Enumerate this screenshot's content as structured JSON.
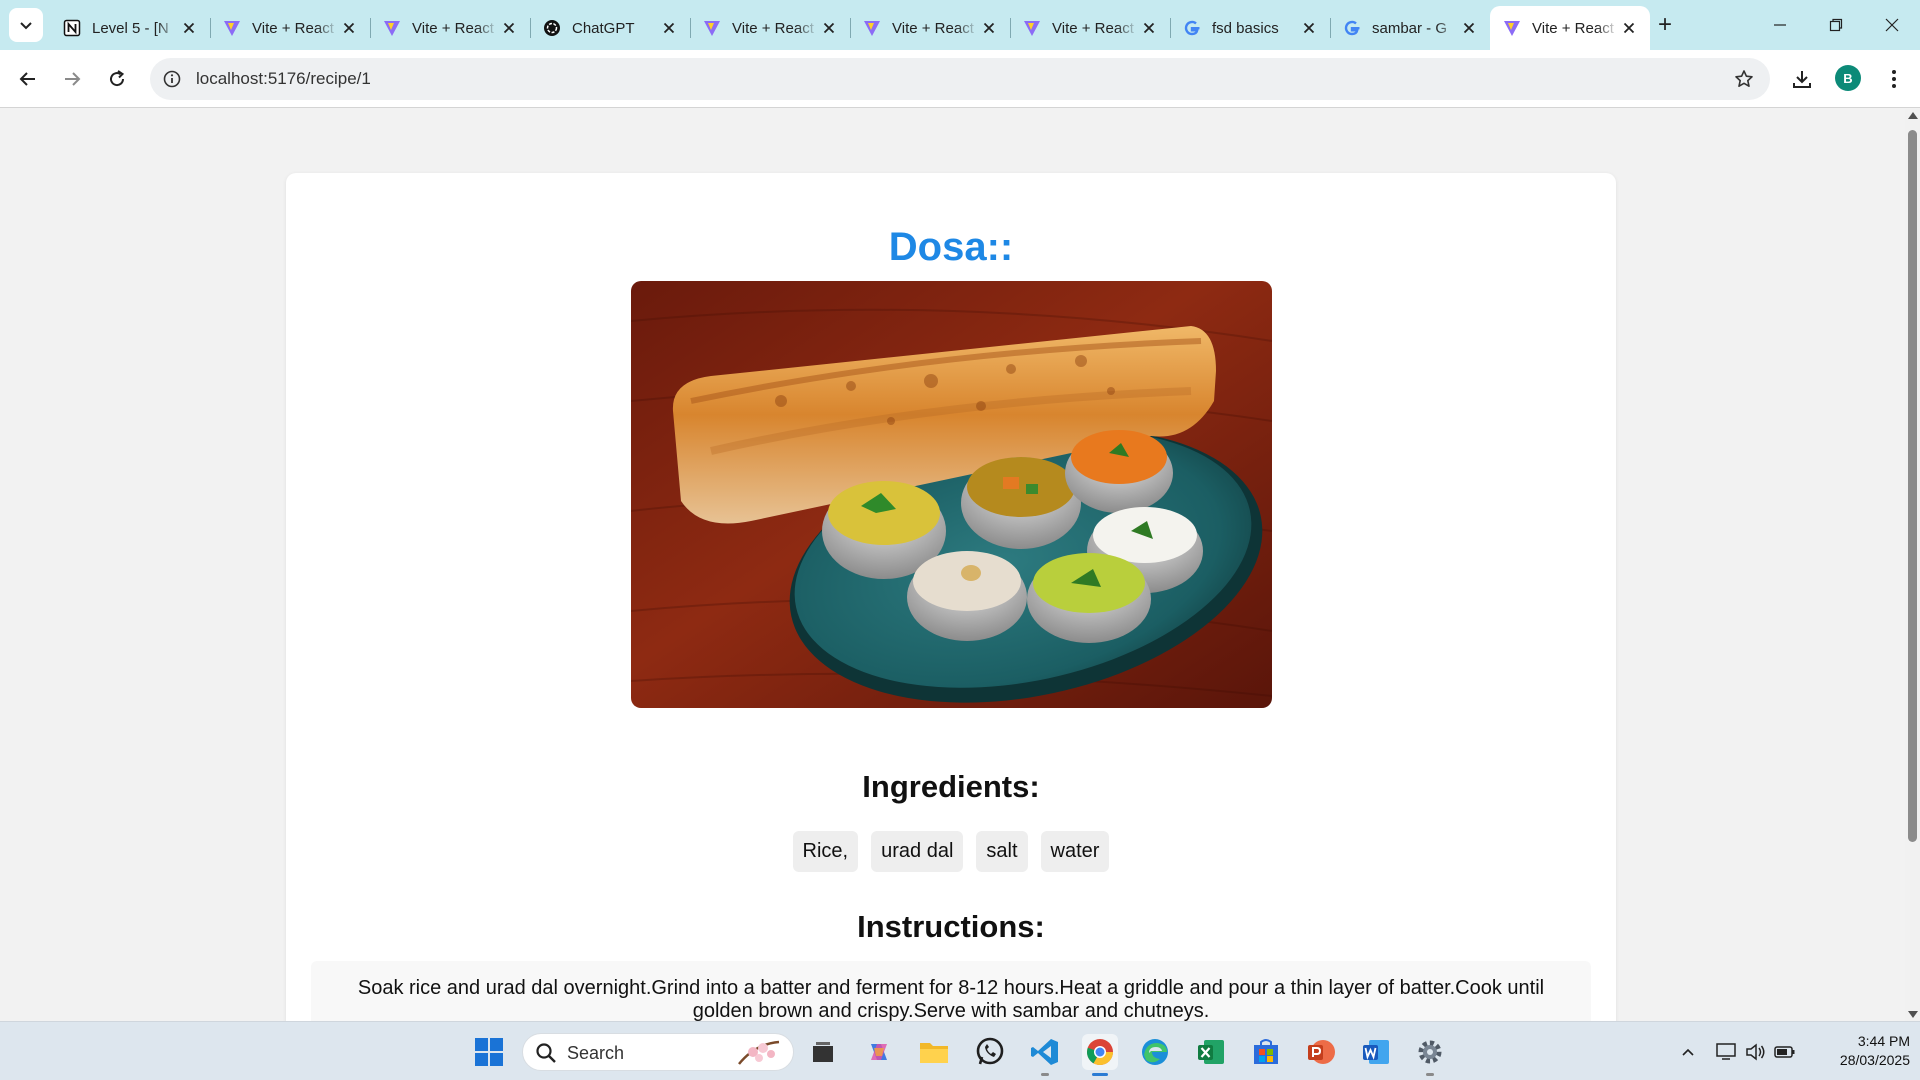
{
  "browser": {
    "tabs": [
      {
        "title": "Level 5 - [N",
        "icon": "notion-icon",
        "active": false
      },
      {
        "title": "Vite + React",
        "icon": "vite-icon",
        "active": false
      },
      {
        "title": "Vite + React",
        "icon": "vite-icon",
        "active": false
      },
      {
        "title": "ChatGPT",
        "icon": "chatgpt-icon",
        "active": false
      },
      {
        "title": "Vite + React",
        "icon": "vite-icon",
        "active": false
      },
      {
        "title": "Vite + React",
        "icon": "vite-icon",
        "active": false
      },
      {
        "title": "Vite + React",
        "icon": "vite-icon",
        "active": false
      },
      {
        "title": "fsd basics",
        "icon": "google-icon",
        "active": false
      },
      {
        "title": "sambar - G",
        "icon": "google-icon",
        "active": false
      },
      {
        "title": "Vite + React",
        "icon": "vite-icon",
        "active": true
      }
    ],
    "url": "localhost:5176/recipe/1",
    "profile_initial": "B",
    "colors": {
      "tabstrip": "#c6eaf0",
      "avatar": "#0c8a78"
    }
  },
  "recipe": {
    "title": "Dosa::",
    "image_alt": "Dosa with chutneys and sambar",
    "ingredients_heading": "Ingredients:",
    "ingredients": [
      "Rice,",
      "urad dal",
      "salt",
      "water"
    ],
    "instructions_heading": "Instructions:",
    "instructions": "Soak rice and urad dal overnight.Grind into a batter and ferment for 8-12 hours.Heat a griddle and pour a thin layer of batter.Cook until golden brown and crispy.Serve with sambar and chutneys.",
    "colors": {
      "title": "#1e88e5"
    }
  },
  "taskbar": {
    "search_placeholder": "Search",
    "apps": [
      "start-icon",
      "task-view-icon",
      "copilot-icon",
      "file-explorer-icon",
      "whatsapp-icon",
      "vscode-icon",
      "chrome-icon",
      "edge-icon",
      "excel-icon",
      "store-icon",
      "powerpoint-icon",
      "word-icon",
      "settings-icon"
    ],
    "time": "3:44 PM",
    "date": "28/03/2025"
  }
}
